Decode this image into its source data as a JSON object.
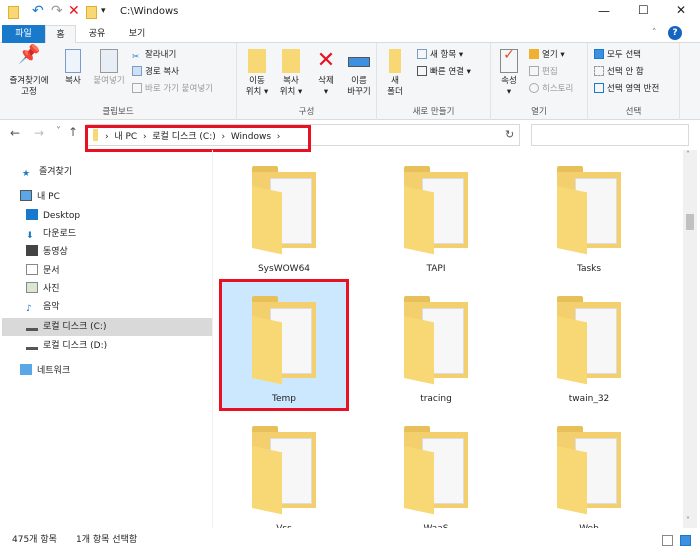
{
  "window": {
    "title": "C:\\Windows",
    "minimize": "—",
    "maximize": "☐",
    "close": "✕",
    "help": "?"
  },
  "tabs": [
    {
      "label": "파일"
    },
    {
      "label": "홈"
    },
    {
      "label": "공유"
    },
    {
      "label": "보기"
    }
  ],
  "ribbon": {
    "clipboard": {
      "label": "클립보드",
      "pin": "즐겨찾기에\n고정",
      "copy": "복사",
      "paste": "붙여넣기",
      "cut": "잘라내기",
      "copy_path": "경로 복사",
      "paste_shortcut": "바로 가기 붙여넣기"
    },
    "organize": {
      "label": "구성",
      "move_to": "이동\n위치 ▾",
      "copy_to": "복사\n위치 ▾",
      "delete": "삭제\n▾",
      "rename": "이름\n바꾸기"
    },
    "new": {
      "label": "새로 만들기",
      "new_folder": "새\n폴더",
      "new_item": "새 항목 ▾",
      "easy_access": "빠른 연결 ▾"
    },
    "open": {
      "label": "열기",
      "properties": "속성\n▾",
      "open": "열기 ▾",
      "edit": "편집",
      "history": "히스토리"
    },
    "select": {
      "label": "선택",
      "select_all": "모두 선택",
      "select_none": "선택 안 함",
      "invert": "선택 영역 반전"
    }
  },
  "address": {
    "crumbs": [
      "내 PC",
      "로컬 디스크 (C:)",
      "Windows"
    ],
    "sep": "›",
    "refresh": "↻",
    "back": "←",
    "forward": "→",
    "recent": "˅",
    "up": "↑"
  },
  "nav": [
    {
      "label": "즐겨찾기"
    },
    {
      "label": "내 PC"
    },
    {
      "label": "Desktop"
    },
    {
      "label": "다운로드"
    },
    {
      "label": "동영상"
    },
    {
      "label": "문서"
    },
    {
      "label": "사진"
    },
    {
      "label": "음악"
    },
    {
      "label": "로컬 디스크 (C:)"
    },
    {
      "label": "로컬 디스크 (D:)"
    },
    {
      "label": "네트워크"
    }
  ],
  "items": [
    {
      "name": "SysWOW64"
    },
    {
      "name": "TAPI"
    },
    {
      "name": "Tasks"
    },
    {
      "name": "Temp"
    },
    {
      "name": "tracing"
    },
    {
      "name": "twain_32"
    },
    {
      "name": "Vss"
    },
    {
      "name": "WaaS"
    },
    {
      "name": "Web"
    }
  ],
  "status": {
    "count": "475개 항목",
    "selected": "1개 항목 선택함"
  },
  "colors": {
    "accent": "#1979ca",
    "selection": "#cce8ff",
    "highlight": "#e81123",
    "folder": "#f8d775"
  }
}
